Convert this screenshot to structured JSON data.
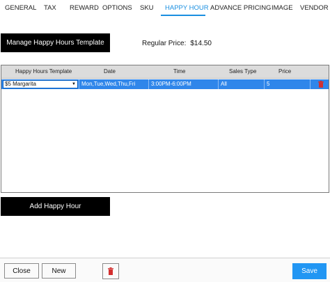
{
  "tabs": [
    {
      "label": "GENERAL"
    },
    {
      "label": "TAX"
    },
    {
      "label": "REWARD"
    },
    {
      "label": "OPTIONS"
    },
    {
      "label": "SKU"
    },
    {
      "label": "HAPPY HOUR",
      "active": true
    },
    {
      "label": "ADVANCE PRICING"
    },
    {
      "label": "IMAGE"
    },
    {
      "label": "VENDOR"
    }
  ],
  "manage_template_label": "Manage Happy Hours Template",
  "regular_price": {
    "label": "Regular Price:",
    "value": "$14.50"
  },
  "grid": {
    "columns": [
      "Happy Hours Template",
      "Date",
      "Time",
      "Sales Type",
      "Price"
    ],
    "rows": [
      {
        "template": "$5 Margarita",
        "date": "Mon,Tue,Wed,Thu,Fri",
        "time": "3:00PM-6:00PM",
        "sales_type": "All",
        "price": "5"
      }
    ]
  },
  "add_happy_hour_label": "Add Happy Hour",
  "footer": {
    "close_label": "Close",
    "new_label": "New",
    "save_label": "Save"
  },
  "colors": {
    "accent": "#1a8fe0",
    "selected_row": "#2f86ea",
    "delete": "#d32f2f",
    "save": "#2196f3"
  },
  "icons": {
    "row_delete": "trash-icon",
    "footer_delete": "trash-icon",
    "combo": "chevron-down-icon"
  }
}
